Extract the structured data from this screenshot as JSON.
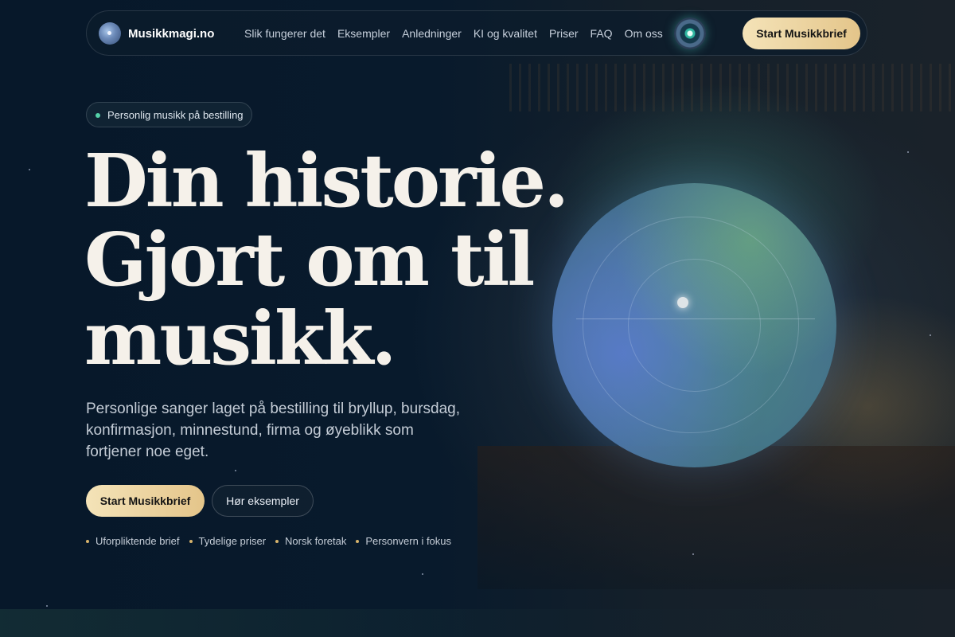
{
  "brand": {
    "name": "Musikkmagi.no"
  },
  "nav": {
    "links": [
      "Slik fungerer det",
      "Eksempler",
      "Anledninger",
      "KI og kvalitet",
      "Priser",
      "FAQ",
      "Om oss"
    ],
    "cta": "Start Musikkbrief"
  },
  "hero": {
    "badge": "Personlig musikk på bestilling",
    "headline": [
      "Din historie.",
      "Gjort om til",
      "musikk."
    ],
    "lede": "Personlige sanger laget på bestilling til bryllup, bursdag, konfirmasjon, minnestund, firma og øyeblikk som fortjener noe eget.",
    "primary_cta": "Start Musikkbrief",
    "secondary_cta": "Hør eksempler",
    "trust": [
      "Uforpliktende brief",
      "Tydelige priser",
      "Norsk foretak",
      "Personvern i fokus"
    ]
  },
  "colors": {
    "accent_gold": "#e4c58a",
    "accent_green": "#54d1a8",
    "background": "#07182a"
  }
}
